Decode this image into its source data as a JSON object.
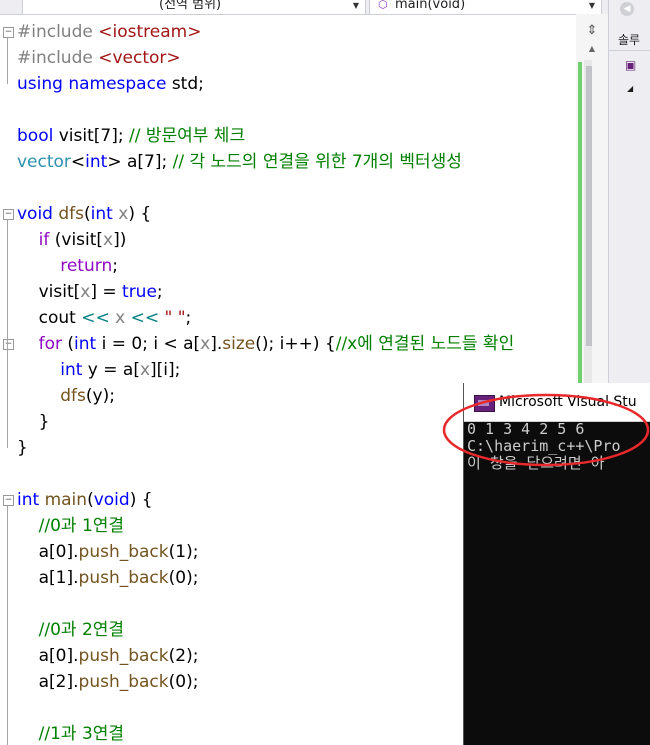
{
  "navbar": {
    "scope_label": "(전역 범위)",
    "function_label": "main(void)"
  },
  "side_panel": {
    "label": "솔루"
  },
  "code_lines": [
    [
      [
        "pp",
        "#include "
      ],
      [
        "str",
        "<iostream>"
      ]
    ],
    [
      [
        "pp",
        "#include "
      ],
      [
        "str",
        "<vector>"
      ]
    ],
    [
      [
        "kw",
        "using"
      ],
      [
        "n",
        " "
      ],
      [
        "kw",
        "namespace"
      ],
      [
        "n",
        " std;"
      ]
    ],
    [],
    [
      [
        "kw",
        "bool"
      ],
      [
        "n",
        " visit[7]; "
      ],
      [
        "cm",
        "// 방문여부 체크"
      ]
    ],
    [
      [
        "ty",
        "vector"
      ],
      [
        "n",
        "<"
      ],
      [
        "kw",
        "int"
      ],
      [
        "n",
        "> a[7]; "
      ],
      [
        "cm",
        "// 각 노드의 연결을 위한 7개의 벡터생성"
      ]
    ],
    [],
    [
      [
        "kw",
        "void"
      ],
      [
        "n",
        " "
      ],
      [
        "fn",
        "dfs"
      ],
      [
        "n",
        "("
      ],
      [
        "kw",
        "int"
      ],
      [
        "n",
        " "
      ],
      [
        "pv",
        "x"
      ],
      [
        "n",
        ") {"
      ]
    ],
    [
      [
        "n",
        "    "
      ],
      [
        "ck",
        "if"
      ],
      [
        "n",
        " (visit["
      ],
      [
        "pv",
        "x"
      ],
      [
        "n",
        "])"
      ]
    ],
    [
      [
        "n",
        "        "
      ],
      [
        "ck",
        "return"
      ],
      [
        "n",
        ";"
      ]
    ],
    [
      [
        "n",
        "    visit["
      ],
      [
        "pv",
        "x"
      ],
      [
        "n",
        "] = "
      ],
      [
        "kw",
        "true"
      ],
      [
        "n",
        ";"
      ]
    ],
    [
      [
        "n",
        "    cout "
      ],
      [
        "op",
        "<<"
      ],
      [
        "n",
        " "
      ],
      [
        "pv",
        "x"
      ],
      [
        "n",
        " "
      ],
      [
        "op",
        "<<"
      ],
      [
        "n",
        " "
      ],
      [
        "str",
        "\" \""
      ],
      [
        "n",
        ";"
      ]
    ],
    [
      [
        "n",
        "    "
      ],
      [
        "ck",
        "for"
      ],
      [
        "n",
        " ("
      ],
      [
        "kw",
        "int"
      ],
      [
        "n",
        " i = 0; i < a["
      ],
      [
        "pv",
        "x"
      ],
      [
        "n",
        "]."
      ],
      [
        "fn",
        "size"
      ],
      [
        "n",
        "(); i++) {"
      ],
      [
        "cm",
        "//x에 연결된 노드들 확인"
      ]
    ],
    [
      [
        "n",
        "        "
      ],
      [
        "kw",
        "int"
      ],
      [
        "n",
        " y = a["
      ],
      [
        "pv",
        "x"
      ],
      [
        "n",
        "][i];"
      ]
    ],
    [
      [
        "n",
        "        "
      ],
      [
        "fn",
        "dfs"
      ],
      [
        "n",
        "(y);"
      ]
    ],
    [
      [
        "n",
        "    }"
      ]
    ],
    [
      [
        "n",
        "}"
      ]
    ],
    [],
    [
      [
        "kw",
        "int"
      ],
      [
        "n",
        " "
      ],
      [
        "fn",
        "main"
      ],
      [
        "n",
        "("
      ],
      [
        "kw",
        "void"
      ],
      [
        "n",
        ") {"
      ]
    ],
    [
      [
        "n",
        "    "
      ],
      [
        "cm",
        "//0과 1연결"
      ]
    ],
    [
      [
        "n",
        "    a[0]."
      ],
      [
        "fn",
        "push_back"
      ],
      [
        "n",
        "(1);"
      ]
    ],
    [
      [
        "n",
        "    a[1]."
      ],
      [
        "fn",
        "push_back"
      ],
      [
        "n",
        "(0);"
      ]
    ],
    [],
    [
      [
        "n",
        "    "
      ],
      [
        "cm",
        "//0과 2연결"
      ]
    ],
    [
      [
        "n",
        "    a[0]."
      ],
      [
        "fn",
        "push_back"
      ],
      [
        "n",
        "(2);"
      ]
    ],
    [
      [
        "n",
        "    a[2]."
      ],
      [
        "fn",
        "push_back"
      ],
      [
        "n",
        "(0);"
      ]
    ],
    [],
    [
      [
        "n",
        "    "
      ],
      [
        "cm",
        "//1과 3연결"
      ]
    ]
  ],
  "console": {
    "title": "Microsoft Visual Stu",
    "lines": [
      "0 1 3 4 2 5 6",
      "C:\\haerim_c++\\Pro",
      "이 창을 닫으려면 아"
    ]
  },
  "colors": {
    "keyword": "#0000ff",
    "comment": "#008000",
    "string": "#a31515",
    "type": "#2b91af",
    "function": "#74531f",
    "param": "#808080",
    "control": "#8f08c4",
    "highlight_circle": "#e8282b"
  }
}
